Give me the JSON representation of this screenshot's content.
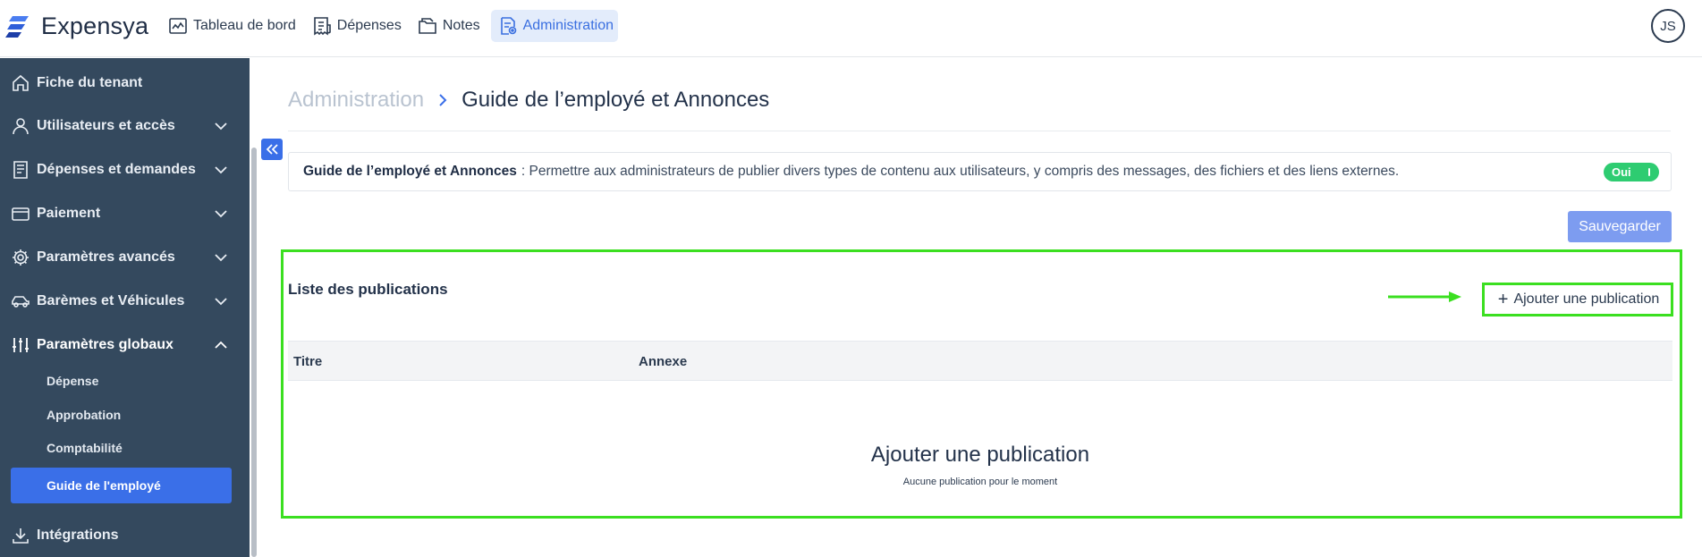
{
  "brand": {
    "name": "Expensya",
    "logo": "expensya-logo"
  },
  "topnav": [
    {
      "label": "Tableau de bord",
      "icon": "dashboard-icon"
    },
    {
      "label": "Dépenses",
      "icon": "receipt-icon"
    },
    {
      "label": "Notes",
      "icon": "folder-icon"
    },
    {
      "label": "Administration",
      "icon": "admin-doc-icon",
      "active": true
    }
  ],
  "user": {
    "initials": "JS"
  },
  "sidebar": {
    "items": [
      {
        "label": "Fiche du tenant",
        "icon": "home-icon"
      },
      {
        "label": "Utilisateurs et accès",
        "icon": "user-icon",
        "expandable": true
      },
      {
        "label": "Dépenses et demandes",
        "icon": "receipt-icon",
        "expandable": true
      },
      {
        "label": "Paiement",
        "icon": "credit-card-icon",
        "expandable": true
      },
      {
        "label": "Paramètres avancés",
        "icon": "gear-icon",
        "expandable": true
      },
      {
        "label": "Barèmes et Véhicules",
        "icon": "car-icon",
        "expandable": true
      },
      {
        "label": "Paramètres globaux",
        "icon": "sliders-icon",
        "expandable": true,
        "expanded": true
      },
      {
        "label": "Intégrations",
        "icon": "download-icon"
      }
    ],
    "subitems": [
      "Dépense",
      "Approbation",
      "Comptabilité",
      "Guide de l'employé"
    ]
  },
  "breadcrumb": {
    "parent": "Administration",
    "current": "Guide de l’employé et Annonces"
  },
  "feature": {
    "name": "Guide de l’employé et Annonces",
    "description": ": Permettre aux administrateurs de publier divers types de contenu aux utilisateurs, y compris des messages, des fichiers et des liens externes.",
    "toggle_label": "Oui",
    "enabled": true
  },
  "actions": {
    "save_label": "Sauvegarder"
  },
  "publications": {
    "title": "Liste des publications",
    "add_label": "Ajouter une publication",
    "columns": [
      "Titre",
      "Annexe"
    ],
    "empty_title": "Ajouter une publication",
    "empty_subtitle": "Aucune publication pour le moment"
  },
  "colors": {
    "sidebar_bg": "#34495e",
    "accent": "#3a6fe8",
    "highlight": "#3bdf20",
    "toggle_on": "#2ecc71"
  }
}
